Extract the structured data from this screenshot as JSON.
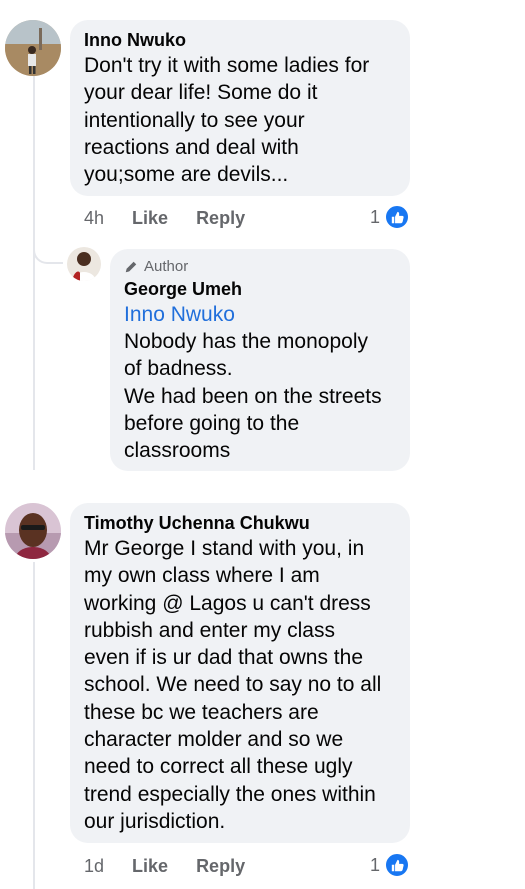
{
  "comments": [
    {
      "author": "Inno Nwuko",
      "text": "Don't try it with some ladies for\nyour dear life! Some do it\nintentionally to see your\nreactions and deal with\nyou;some are devils...",
      "time": "4h",
      "like_label": "Like",
      "reply_label": "Reply",
      "reaction_count": "1",
      "reaction_icon": "like-icon"
    },
    {
      "badge": "Author",
      "badge_icon": "pencil-icon",
      "author": "George Umeh",
      "mention": "Inno Nwuko",
      "text": "Nobody has the monopoly\nof badness.\nWe had been on the streets\nbefore going to the\nclassrooms"
    },
    {
      "author": "Timothy Uchenna Chukwu",
      "text": "Mr George I stand with you, in\nmy own class where I am\nworking @ Lagos u can't dress\nrubbish and enter my class\neven if is ur dad that owns the\nschool. We need to say no to all\nthese bc we teachers are\ncharacter molder and so we\nneed to correct all these ugly\ntrend especially the ones within\nour jurisdiction.",
      "time": "1d",
      "like_label": "Like",
      "reply_label": "Reply",
      "reaction_count": "1",
      "reaction_icon": "like-icon"
    }
  ],
  "colors": {
    "bubble": "#f0f2f5",
    "mention": "#216fdb",
    "like_blue": "#1877f2",
    "meta_gray": "#65676b"
  }
}
